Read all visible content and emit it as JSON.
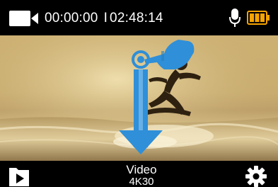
{
  "status": {
    "elapsed": "00:00:00",
    "separator": "I",
    "remaining": "02:48:14",
    "mode_icon": "video-camera-icon",
    "mic_icon": "microphone-icon",
    "battery_icon": "battery-icon",
    "battery_color": "#f5a300"
  },
  "gesture_hint": {
    "icon": "swipe-down-hand-icon",
    "direction": "down",
    "color": "#2f8fd8"
  },
  "bottom": {
    "playback_icon": "playback-icon",
    "mode_label": "Video",
    "resolution_label": "4K30",
    "settings_icon": "gear-icon"
  }
}
